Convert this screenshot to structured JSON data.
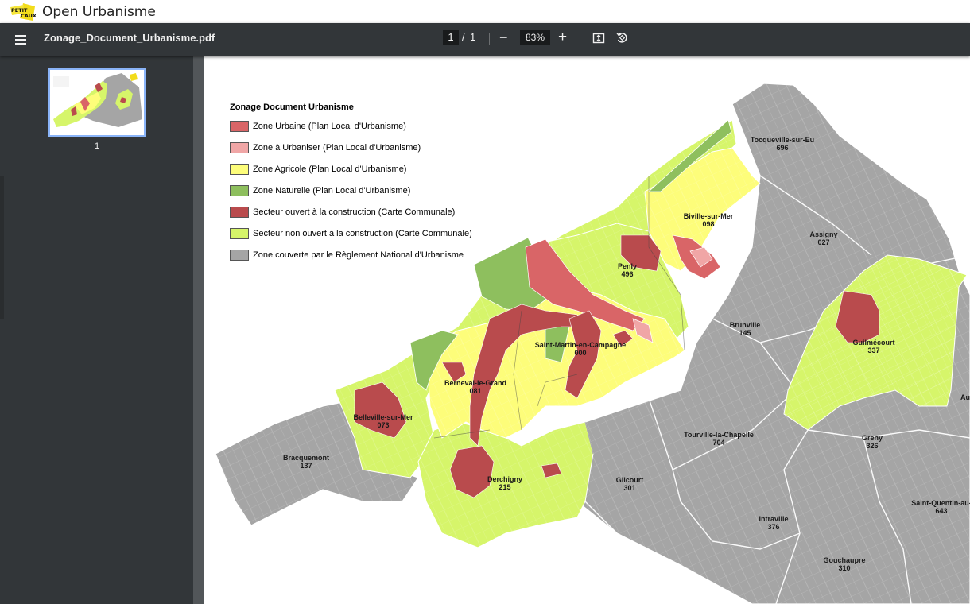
{
  "app": {
    "title": "Open Urbanisme",
    "logo_text": "PETIT CAUX"
  },
  "toolbar": {
    "document_title": "Zonage_Document_Urbanisme.pdf",
    "page_current": "1",
    "page_separator": "/",
    "page_total": "1",
    "zoom_out_label": "−",
    "zoom_level": "83%",
    "zoom_in_label": "+"
  },
  "sidebar": {
    "thumbnails": [
      {
        "label": "1"
      }
    ]
  },
  "legend": {
    "title": "Zonage Document Urbanisme",
    "items": [
      {
        "label": "Zone Urbaine (Plan Local d'Urbanisme)",
        "color": "#d96567"
      },
      {
        "label": "Zone à Urbaniser (Plan Local d'Urbanisme)",
        "color": "#f0a6a6"
      },
      {
        "label": "Zone Agricole (Plan Local d'Urbanisme)",
        "color": "#fdfd7a"
      },
      {
        "label": "Zone Naturelle (Plan Local d'Urbanisme)",
        "color": "#8ebf5e"
      },
      {
        "label": "Secteur ouvert à la construction (Carte Communale)",
        "color": "#b94b4d"
      },
      {
        "label": "Secteur non ouvert à la construction (Carte Communale)",
        "color": "#d6f56a"
      },
      {
        "label": "Zone couverte par le Règlement National d'Urbanisme",
        "color": "#a5a5a5"
      }
    ]
  },
  "communes": [
    {
      "name": "Tocqueville-sur-Eu",
      "code": "696"
    },
    {
      "name": "Biville-sur-Mer",
      "code": "098"
    },
    {
      "name": "Assigny",
      "code": "027"
    },
    {
      "name": "Penly",
      "code": "496"
    },
    {
      "name": "Brunville",
      "code": "145"
    },
    {
      "name": "Guilmécourt",
      "code": "337"
    },
    {
      "name": "Saint-Martin-en-Campagne",
      "code": "000"
    },
    {
      "name": "Berneval-le-Grand",
      "code": "081"
    },
    {
      "name": "Belleville-sur-Mer",
      "code": "073"
    },
    {
      "name": "Bracquemont",
      "code": "137"
    },
    {
      "name": "Tourville-la-Chapelle",
      "code": "704"
    },
    {
      "name": "Greny",
      "code": "326"
    },
    {
      "name": "Glicourt",
      "code": "301"
    },
    {
      "name": "Derchigny",
      "code": "215"
    },
    {
      "name": "Intraville",
      "code": "376"
    },
    {
      "name": "Saint-Quentin-au-",
      "code": "643"
    },
    {
      "name": "Gouchaupre",
      "code": "310"
    },
    {
      "name": "Au",
      "code": ""
    }
  ],
  "colors": {
    "toolbar": "#323639",
    "viewer": "#525659",
    "thumb_border": "#8ab4f8",
    "parcel_line": "#ffffff"
  }
}
